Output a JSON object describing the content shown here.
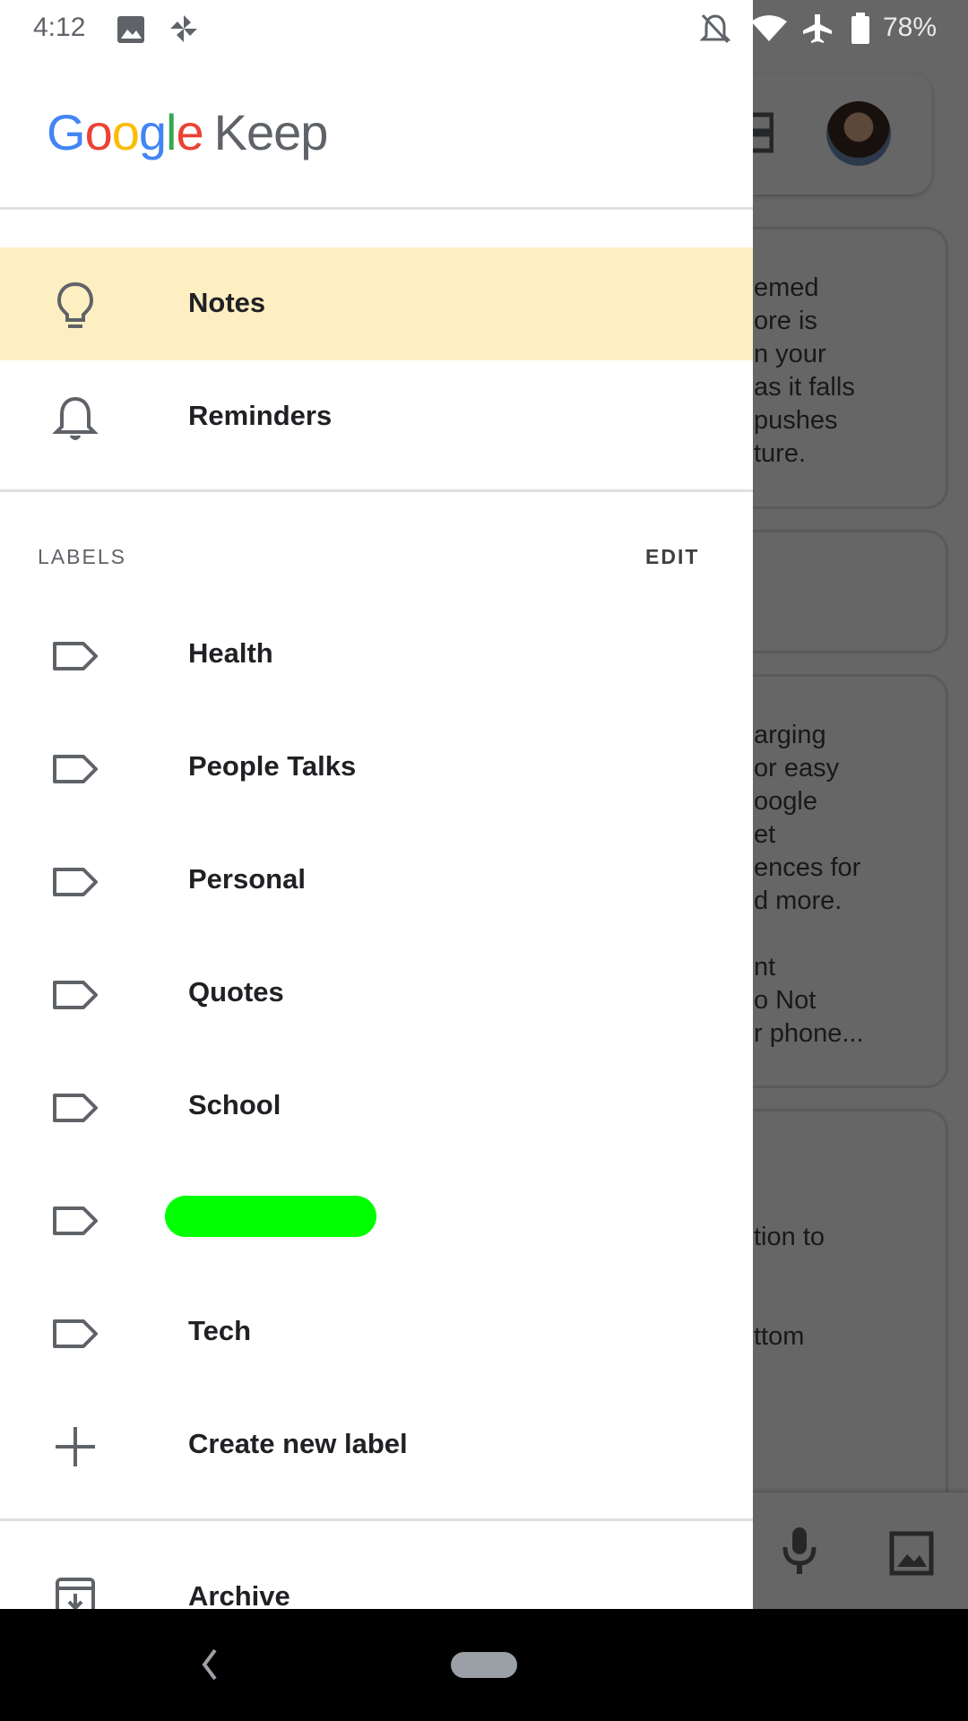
{
  "status_bar": {
    "time": "4:12",
    "battery": "78%",
    "icons": [
      "image-icon",
      "pinwheel-icon",
      "notifications-off-icon",
      "wifi-icon",
      "airplane-icon",
      "battery-icon"
    ]
  },
  "drawer": {
    "logo": {
      "google": [
        "G",
        "o",
        "o",
        "g",
        "l",
        "e"
      ],
      "product": "Keep"
    },
    "nav": [
      {
        "label": "Notes",
        "icon": "lightbulb-icon",
        "active": true
      },
      {
        "label": "Reminders",
        "icon": "bell-icon",
        "active": false
      }
    ],
    "labels_header": "LABELS",
    "labels_edit": "EDIT",
    "labels": [
      {
        "label": "Health",
        "icon": "label-icon"
      },
      {
        "label": "People Talks",
        "icon": "label-icon"
      },
      {
        "label": "Personal",
        "icon": "label-icon"
      },
      {
        "label": "Quotes",
        "icon": "label-icon"
      },
      {
        "label": "School",
        "icon": "label-icon"
      },
      {
        "label": "",
        "icon": "label-icon",
        "redacted": true
      },
      {
        "label": "Tech",
        "icon": "label-icon"
      }
    ],
    "create_label": "Create new label",
    "archive": "Archive",
    "colors": {
      "active_bg": "#feefc3",
      "redaction": "#00ff00"
    }
  },
  "background": {
    "card1_lines": [
      "emed",
      "ore is",
      "n your",
      "as it falls",
      "pushes",
      "ture."
    ],
    "card3_lines": [
      "arging",
      "or easy",
      "oogle",
      "et",
      "ences for",
      "d more.",
      "",
      "nt",
      "o Not",
      "r phone..."
    ],
    "card4_lines": [
      "tion to",
      "",
      "",
      "ttom"
    ]
  }
}
